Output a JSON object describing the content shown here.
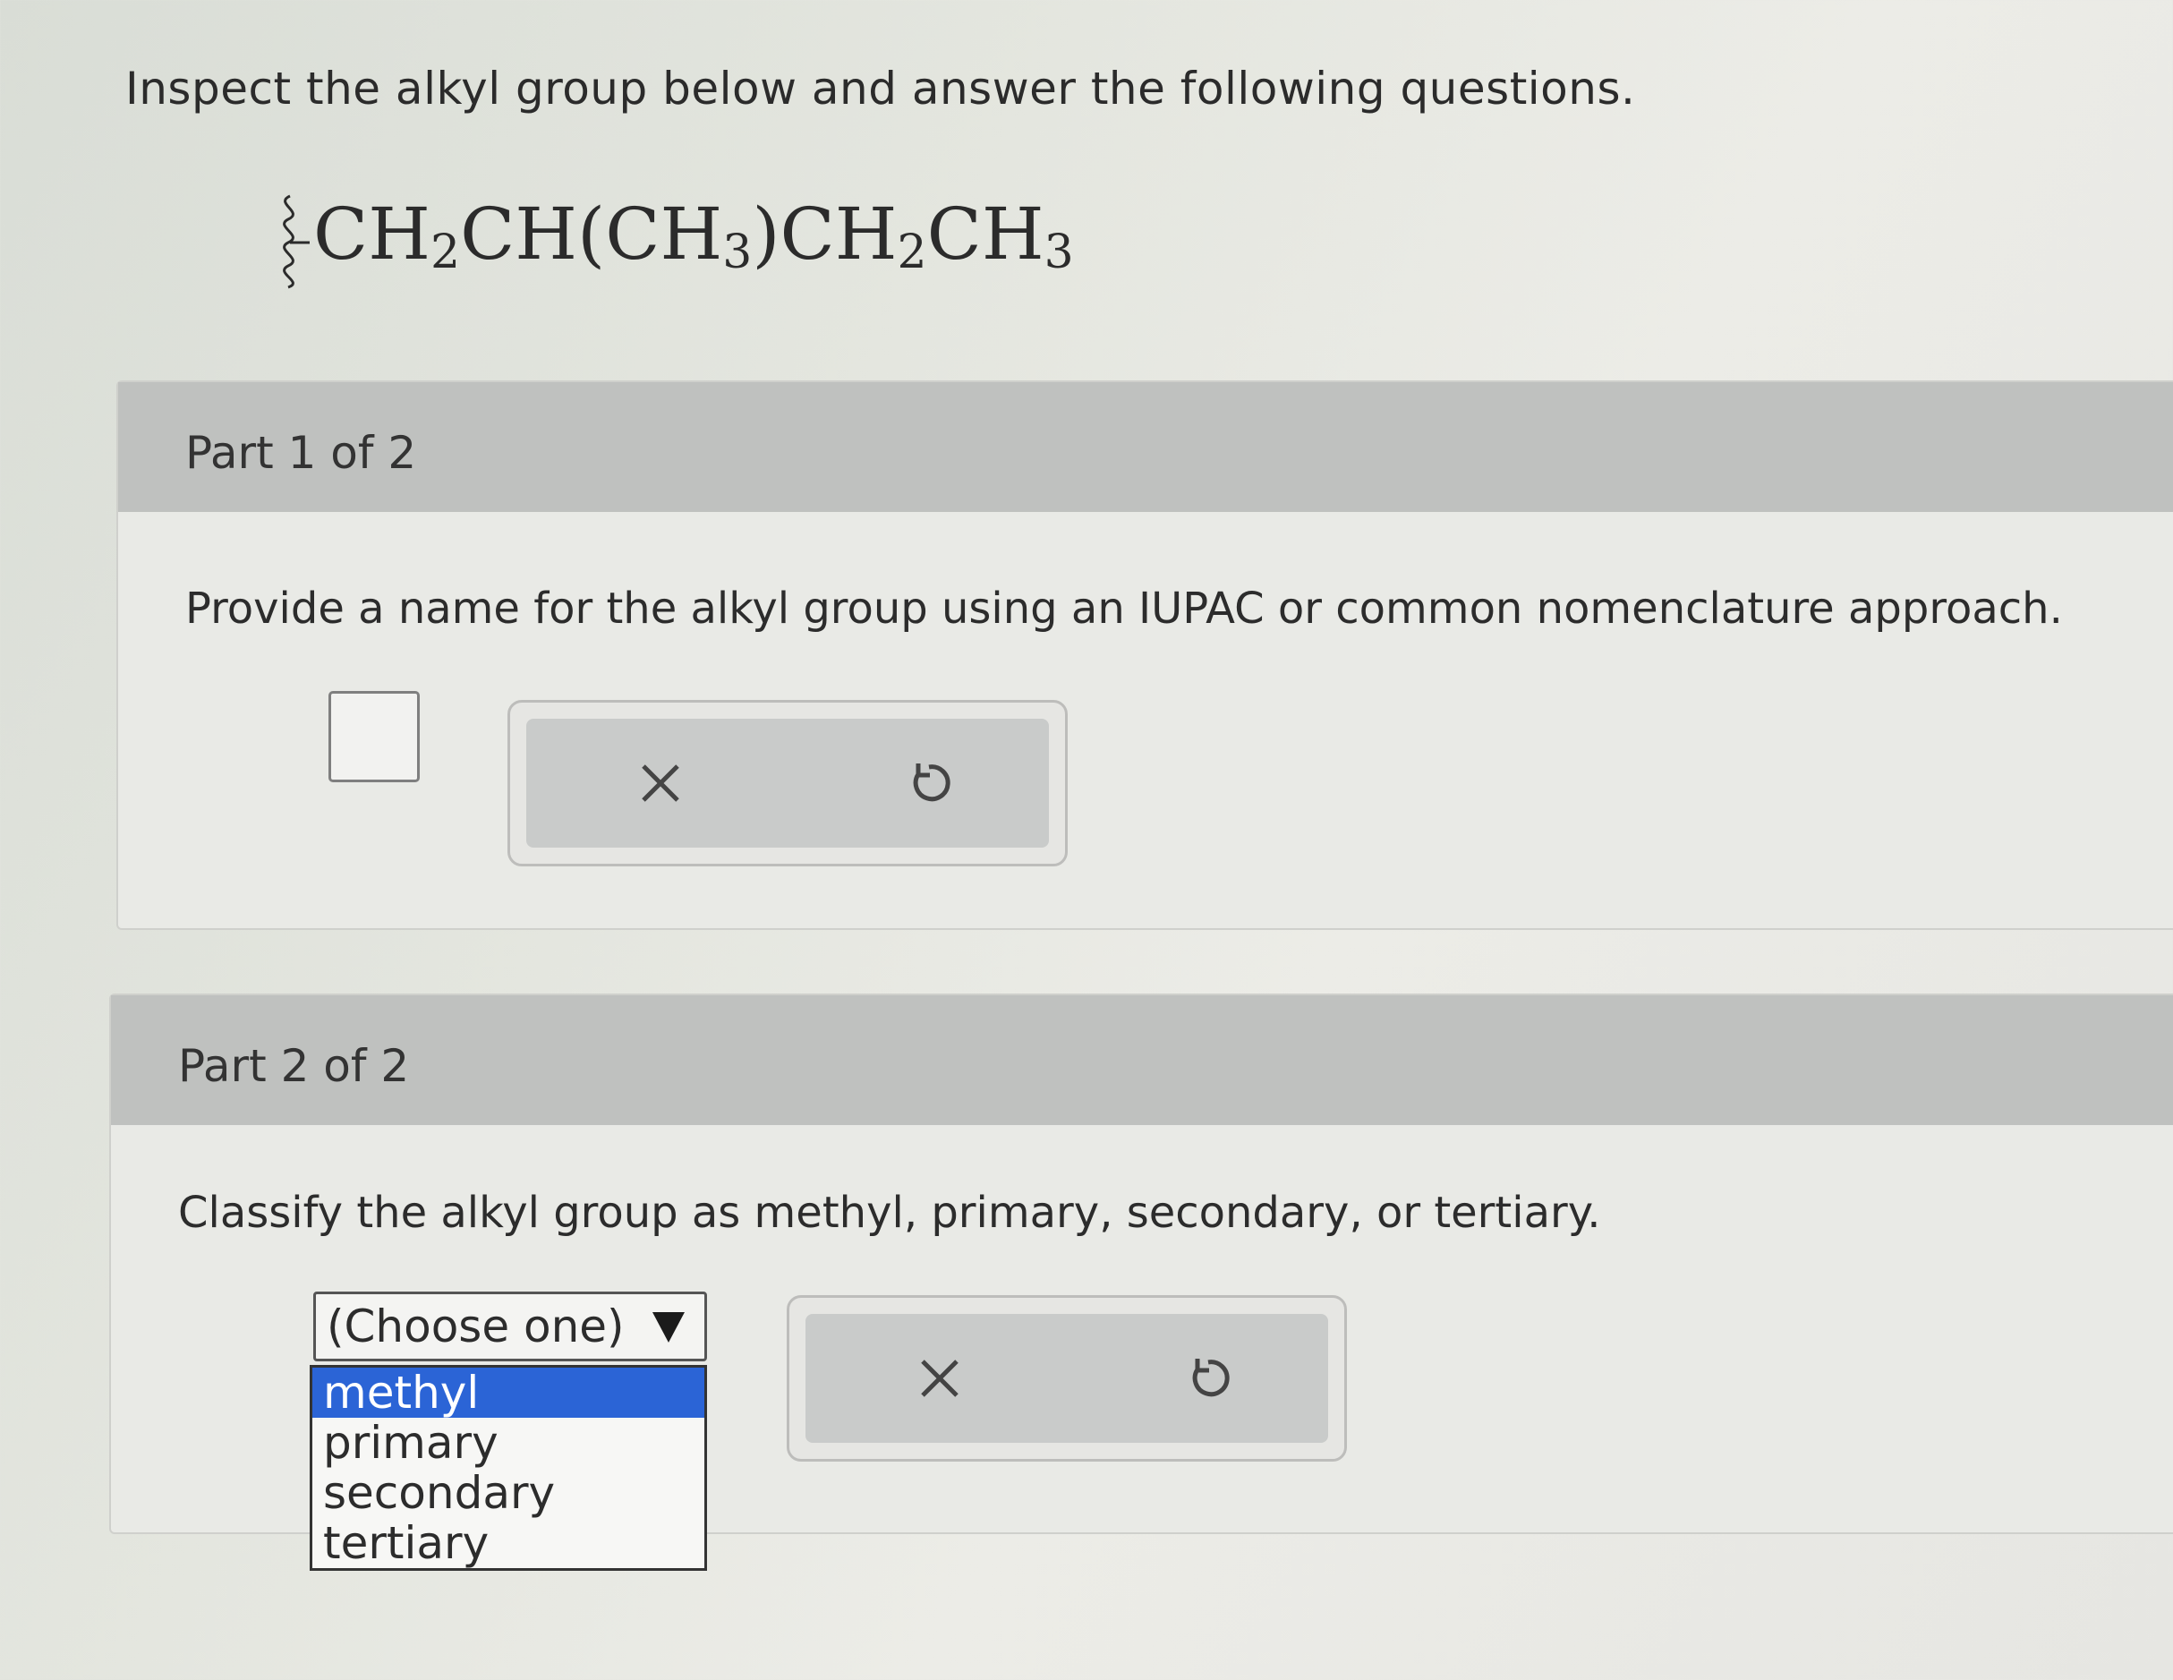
{
  "intro": "Inspect the alkyl group below and answer the following questions.",
  "formula": {
    "p1": "CH",
    "s1": "2",
    "p2": "CH(CH",
    "s2": "3",
    "p3": ")CH",
    "s3": "2",
    "p4": "CH",
    "s4": "3"
  },
  "part1": {
    "label": "Part 1 of 2",
    "question": "Provide a name for the alkyl group using an IUPAC or common nomenclature approach."
  },
  "part2": {
    "label": "Part 2 of 2",
    "question": "Classify the alkyl group as methyl, primary, secondary, or tertiary.",
    "select_value": "(Choose one)",
    "options": [
      "methyl",
      "primary",
      "secondary",
      "tertiary"
    ],
    "highlighted_option": "methyl"
  },
  "icons": {
    "clear": "close-icon",
    "undo": "undo-icon"
  },
  "colors": {
    "header": "#bfc1bf",
    "highlight": "#2b64d6"
  }
}
